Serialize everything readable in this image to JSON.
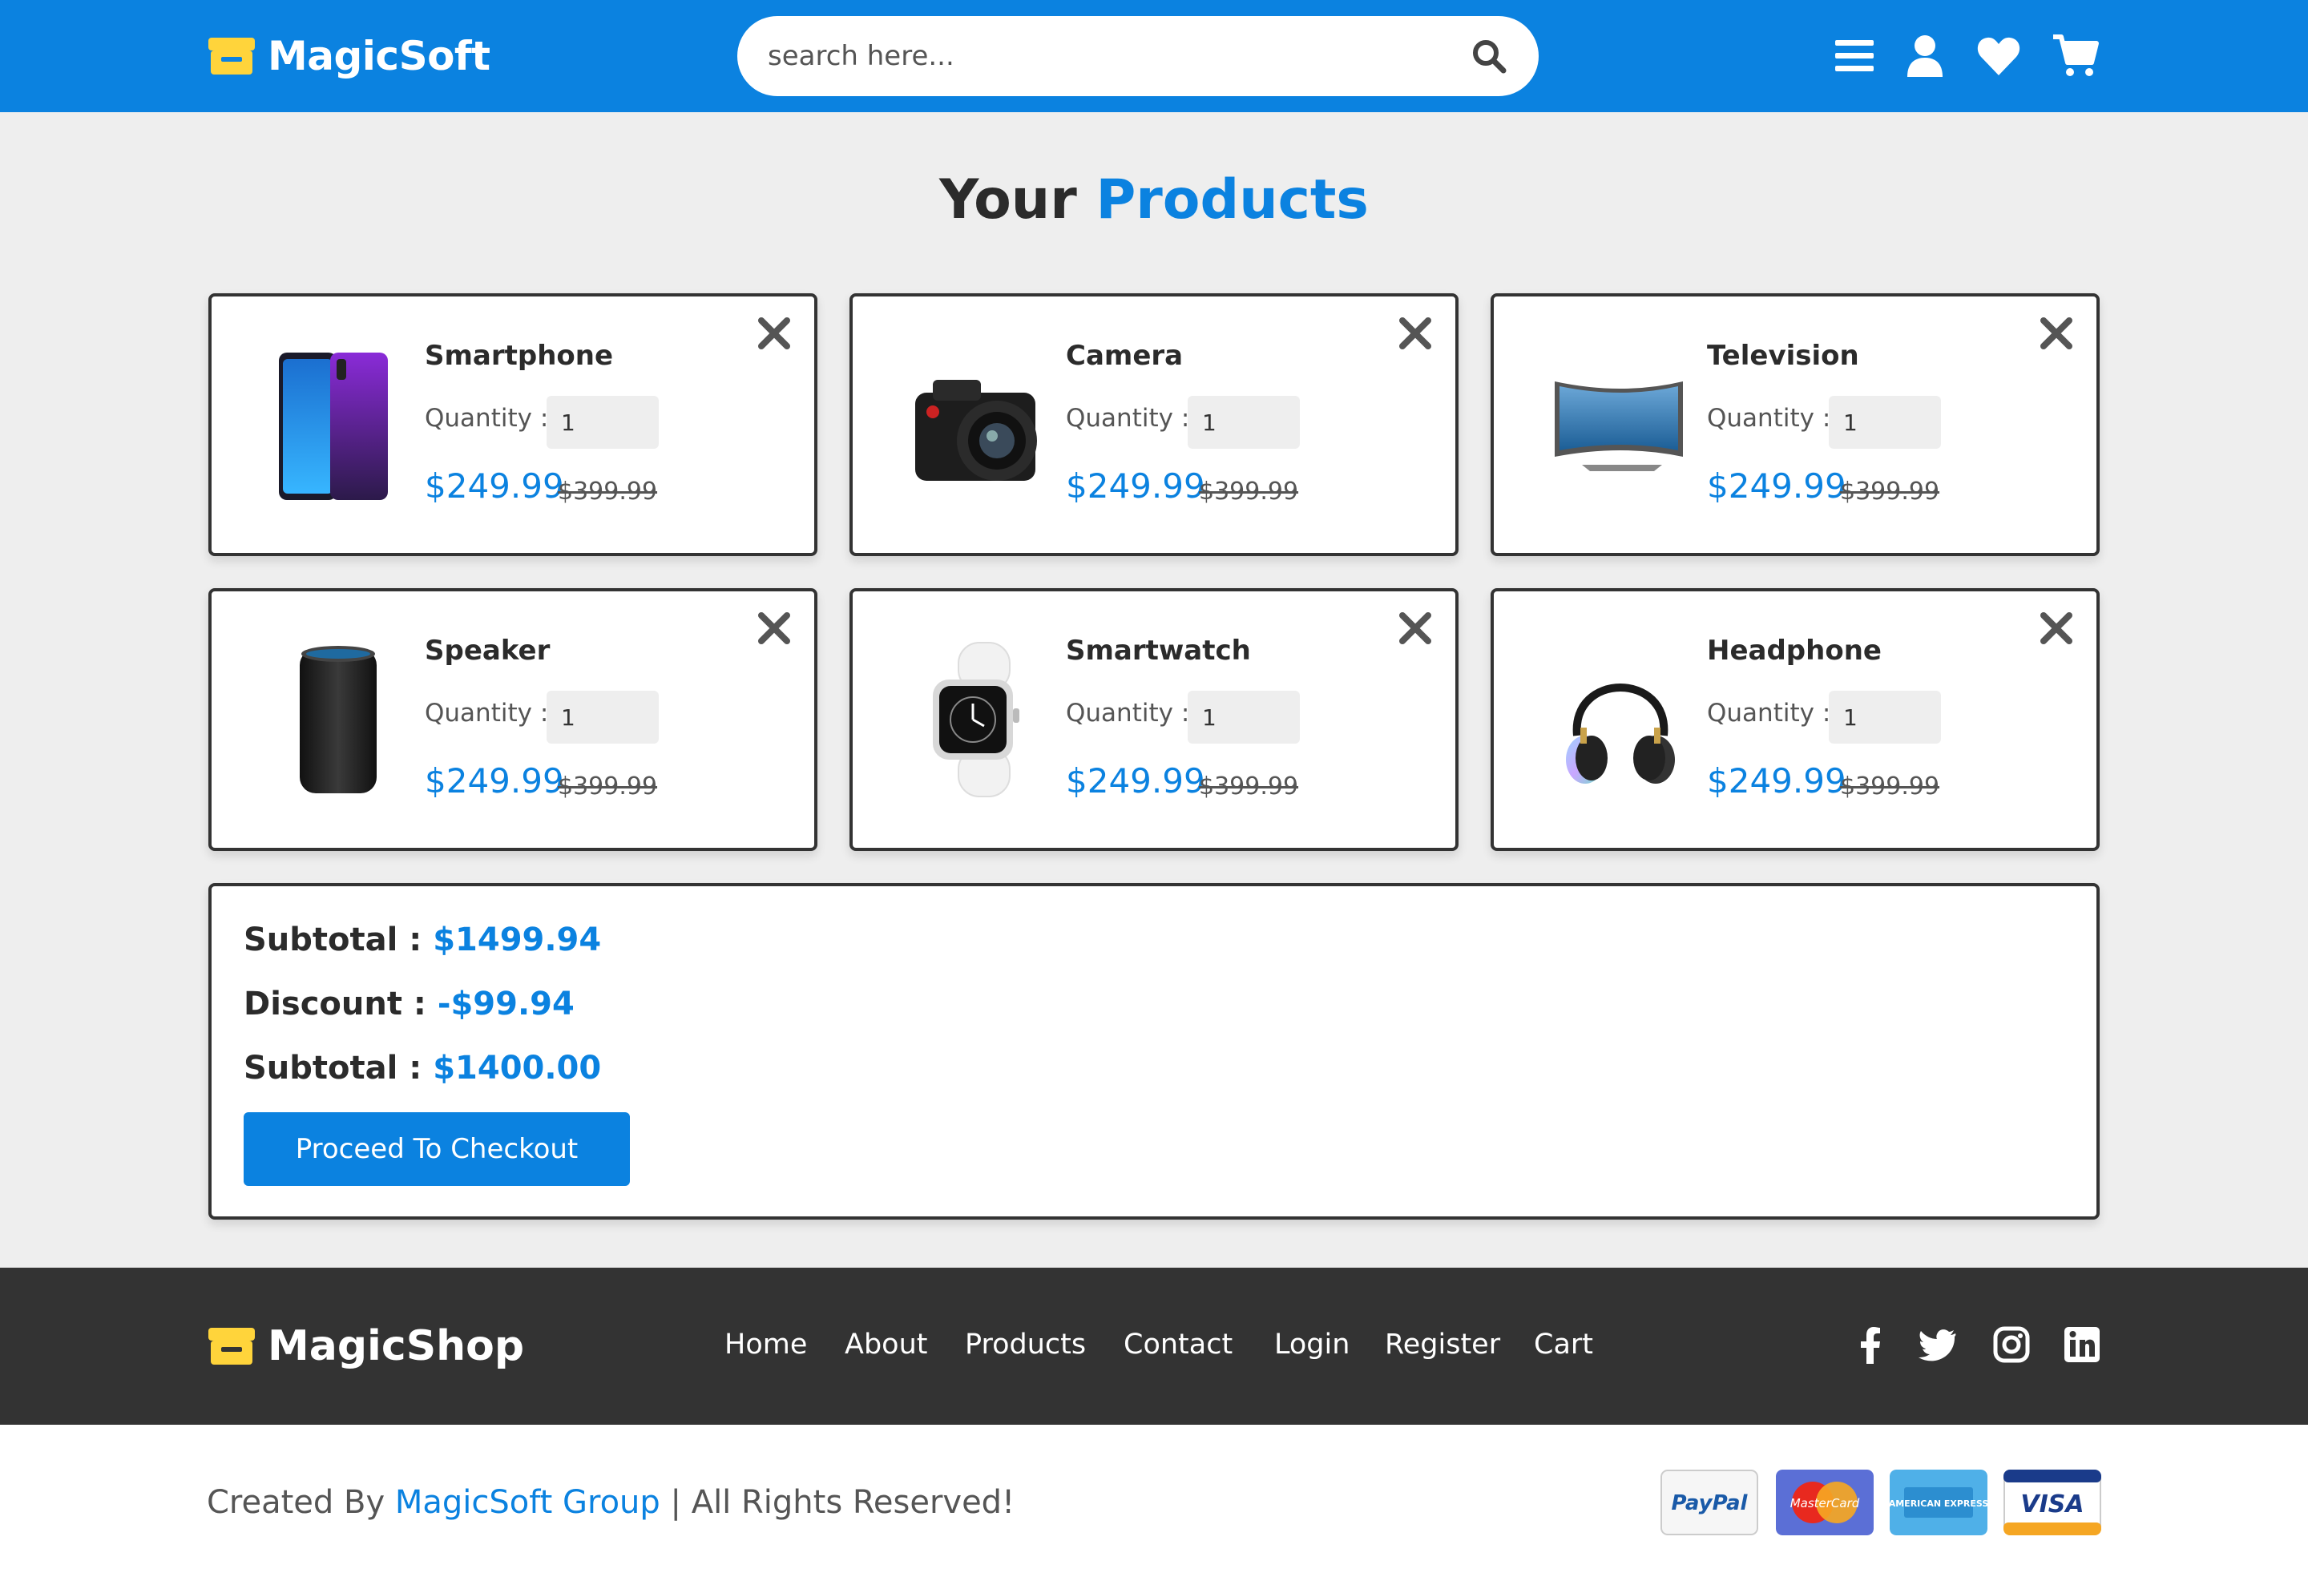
{
  "header": {
    "brand": "MagicSoft",
    "search_placeholder": "search here...",
    "icons": [
      "menu-icon",
      "user-icon",
      "heart-icon",
      "cart-icon"
    ]
  },
  "title": {
    "prefix": "Your",
    "accent": "Products"
  },
  "colors": {
    "accent": "#0b82e0",
    "dark": "#333333",
    "bg": "#eeeeee"
  },
  "products": [
    {
      "name": "Smartphone",
      "qty_label": "Quantity :",
      "qty": "1",
      "price": "$249.99",
      "old_price": "$399.99",
      "image": "smartphone-image"
    },
    {
      "name": "Camera",
      "qty_label": "Quantity :",
      "qty": "1",
      "price": "$249.99",
      "old_price": "$399.99",
      "image": "camera-image"
    },
    {
      "name": "Television",
      "qty_label": "Quantity :",
      "qty": "1",
      "price": "$249.99",
      "old_price": "$399.99",
      "image": "television-image"
    },
    {
      "name": "Speaker",
      "qty_label": "Quantity :",
      "qty": "1",
      "price": "$249.99",
      "old_price": "$399.99",
      "image": "speaker-image"
    },
    {
      "name": "Smartwatch",
      "qty_label": "Quantity :",
      "qty": "1",
      "price": "$249.99",
      "old_price": "$399.99",
      "image": "smartwatch-image"
    },
    {
      "name": "Headphone",
      "qty_label": "Quantity :",
      "qty": "1",
      "price": "$249.99",
      "old_price": "$399.99",
      "image": "headphone-image"
    }
  ],
  "summary": {
    "subtotal_label": "Subtotal :",
    "subtotal_value": "$1499.94",
    "discount_label": "Discount :",
    "discount_value": "-$99.94",
    "total_label": "Subtotal :",
    "total_value": "$1400.00",
    "checkout_label": "Proceed To Checkout"
  },
  "footer": {
    "brand": "MagicShop",
    "nav": [
      "Home",
      "About",
      "Products",
      "Contact",
      "Login",
      "Register",
      "Cart"
    ],
    "social": [
      "facebook-icon",
      "twitter-icon",
      "instagram-icon",
      "linkedin-icon"
    ]
  },
  "bottom": {
    "created_by": "Created By",
    "company": "MagicSoft Group",
    "rights": "| All Rights Reserved!",
    "payments": [
      "PayPal",
      "MasterCard",
      "AMERICAN EXPRESS",
      "VISA"
    ]
  }
}
